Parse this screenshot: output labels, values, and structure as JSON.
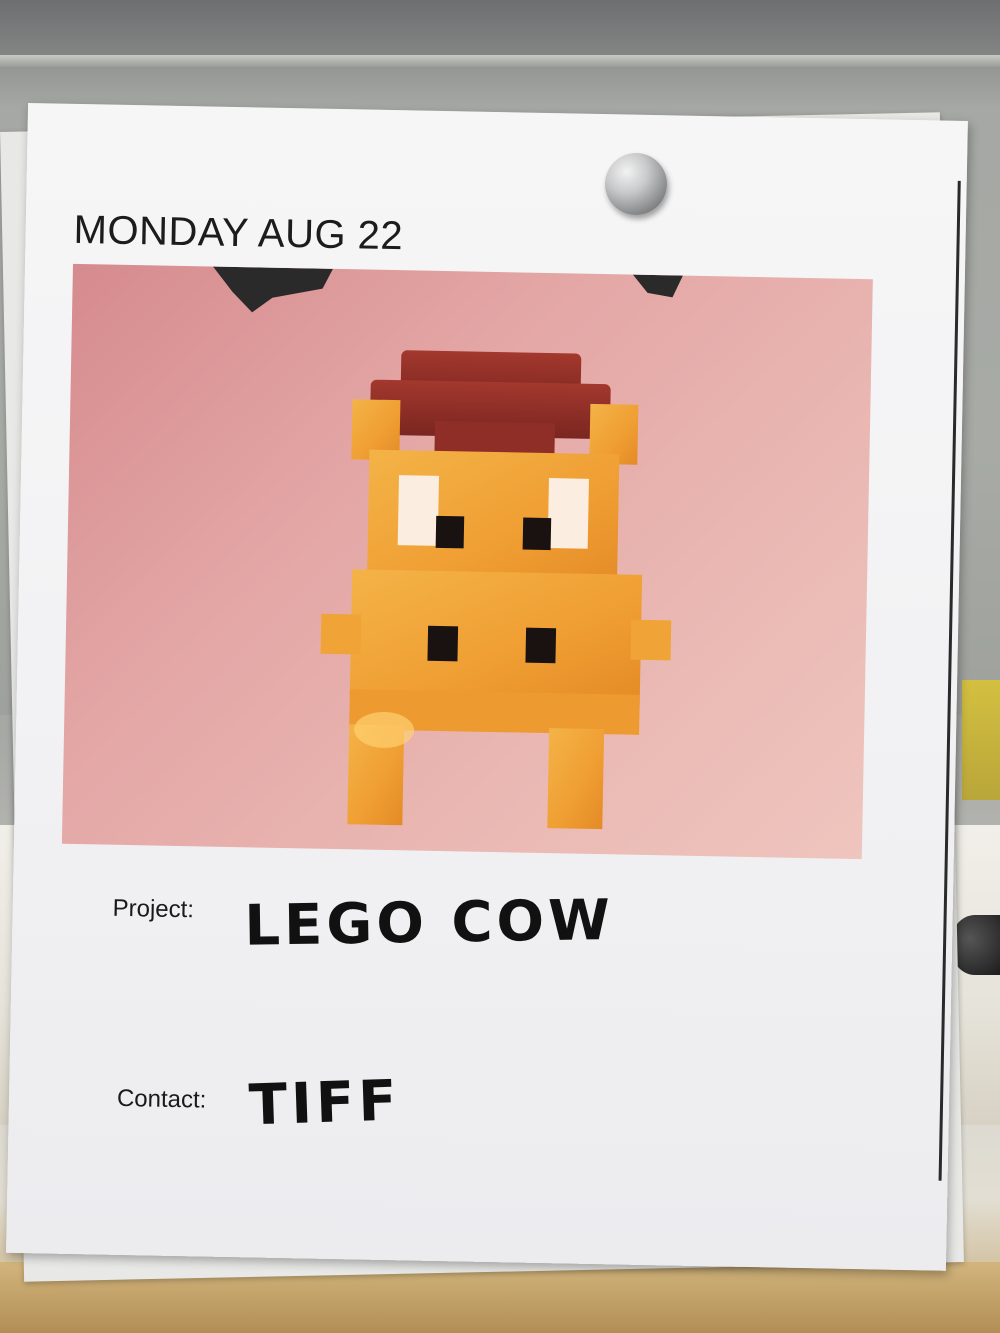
{
  "sign": {
    "date": "MONDAY AUG 22",
    "project_label": "Project:",
    "project_value": "LEGO COW",
    "contact_label": "Contact:",
    "contact_value": "TIFF"
  },
  "colors": {
    "paper": "#f4f4f6",
    "photo_background": "#e3a6a5",
    "cow_orange": "#f0a437",
    "hat_red": "#8e2e26",
    "ink": "#111111"
  }
}
